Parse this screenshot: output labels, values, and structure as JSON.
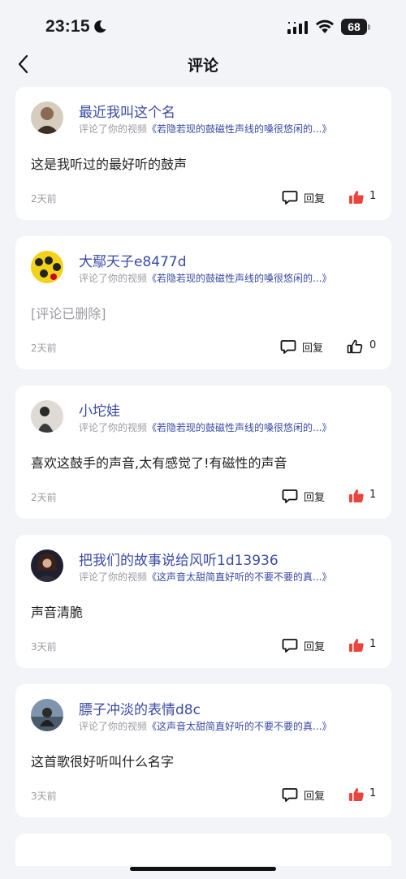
{
  "status_bar": {
    "time": "23:15",
    "battery_percent": "68",
    "icons": [
      "moon-icon",
      "cellular-signal-icon",
      "wifi-icon",
      "battery-icon"
    ]
  },
  "nav": {
    "title": "评论",
    "back_icon": "chevron-left-icon"
  },
  "colors": {
    "accent": "#3b4aa3",
    "like_active": "#e8453c",
    "background": "#f3f4f8",
    "card": "#ffffff",
    "muted": "#9b9ba3"
  },
  "comments": [
    {
      "username": "最近我叫这个名",
      "action_text": "评论了你的视频",
      "video_title": "《若隐若现的鼓磁性声线的嗓很悠闲的...》",
      "content": "这是我听过的最好听的鼓声",
      "time": "2天前",
      "reply_label": "回复",
      "likes": "1",
      "liked": true
    },
    {
      "username": "大鄢天子e8477d",
      "action_text": "评论了你的视频",
      "video_title": "《若隐若现的鼓磁性声线的嗓很悠闲的...》",
      "content": "[评论已删除]",
      "time": "2天前",
      "reply_label": "回复",
      "likes": "0",
      "liked": false
    },
    {
      "username": "小坨娃",
      "action_text": "评论了你的视频",
      "video_title": "《若隐若现的鼓磁性声线的嗓很悠闲的...》",
      "content": "喜欢这鼓手的声音,太有感觉了!有磁性的声音",
      "time": "2天前",
      "reply_label": "回复",
      "likes": "1",
      "liked": true
    },
    {
      "username": "把我们的故事说给风听1d13936",
      "action_text": "评论了你的视频",
      "video_title": "《这声音太甜简直好听的不要不要的真...》",
      "content": "声音清脆",
      "time": "3天前",
      "reply_label": "回复",
      "likes": "1",
      "liked": true
    },
    {
      "username": "膘子冲淡的表情d8c",
      "action_text": "评论了你的视频",
      "video_title": "《这声音太甜简直好听的不要不要的真...》",
      "content": "这首歌很好听叫什么名字",
      "time": "3天前",
      "reply_label": "回复",
      "likes": "1",
      "liked": true
    }
  ]
}
